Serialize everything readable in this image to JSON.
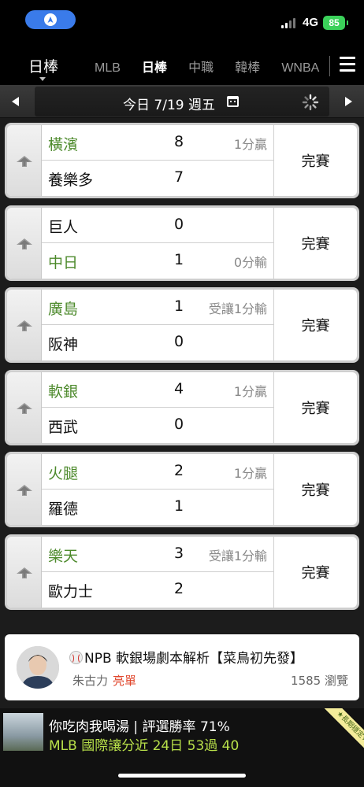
{
  "status_bar": {
    "network": "4G",
    "battery": "85"
  },
  "league_nav": {
    "current": "日棒",
    "tabs": [
      "MLB",
      "日棒",
      "中職",
      "韓棒",
      "WNBA"
    ],
    "active_tab": "日棒"
  },
  "date_bar": {
    "label": "今日 7/19 週五"
  },
  "games": [
    {
      "status": "完賽",
      "teams": [
        {
          "name": "橫濱",
          "score": "8",
          "odds": "1分贏",
          "winner": true
        },
        {
          "name": "養樂多",
          "score": "7",
          "odds": "",
          "winner": false
        }
      ]
    },
    {
      "status": "完賽",
      "teams": [
        {
          "name": "巨人",
          "score": "0",
          "odds": "",
          "winner": false
        },
        {
          "name": "中日",
          "score": "1",
          "odds": "0分輸",
          "winner": true
        }
      ]
    },
    {
      "status": "完賽",
      "teams": [
        {
          "name": "廣島",
          "score": "1",
          "odds": "受讓1分輸",
          "winner": true
        },
        {
          "name": "阪神",
          "score": "0",
          "odds": "",
          "winner": false
        }
      ]
    },
    {
      "status": "完賽",
      "teams": [
        {
          "name": "軟銀",
          "score": "4",
          "odds": "1分贏",
          "winner": true
        },
        {
          "name": "西武",
          "score": "0",
          "odds": "",
          "winner": false
        }
      ]
    },
    {
      "status": "完賽",
      "teams": [
        {
          "name": "火腿",
          "score": "2",
          "odds": "1分贏",
          "winner": true
        },
        {
          "name": "羅德",
          "score": "1",
          "odds": "",
          "winner": false
        }
      ]
    },
    {
      "status": "完賽",
      "teams": [
        {
          "name": "樂天",
          "score": "3",
          "odds": "受讓1分輸",
          "winner": true
        },
        {
          "name": "歐力士",
          "score": "2",
          "odds": "",
          "winner": false
        }
      ]
    }
  ],
  "article": {
    "title": "NPB 軟銀場劇本解析【菜鳥初先發】",
    "author": "朱古力",
    "tag": "亮單",
    "views": "1585 瀏覽"
  },
  "banner": {
    "line1": "你吃肉我喝湯 | 評選勝率 71%",
    "line2": "MLB 國際讓分近 24日 53過 40",
    "ribbon": "★長期穩定★"
  },
  "colors": {
    "win_team": "#4d8a2c",
    "tag": "#e0452b",
    "banner_highlight": "#b8e04a",
    "battery": "#3bd15a",
    "location_pill": "#3a7bea"
  }
}
